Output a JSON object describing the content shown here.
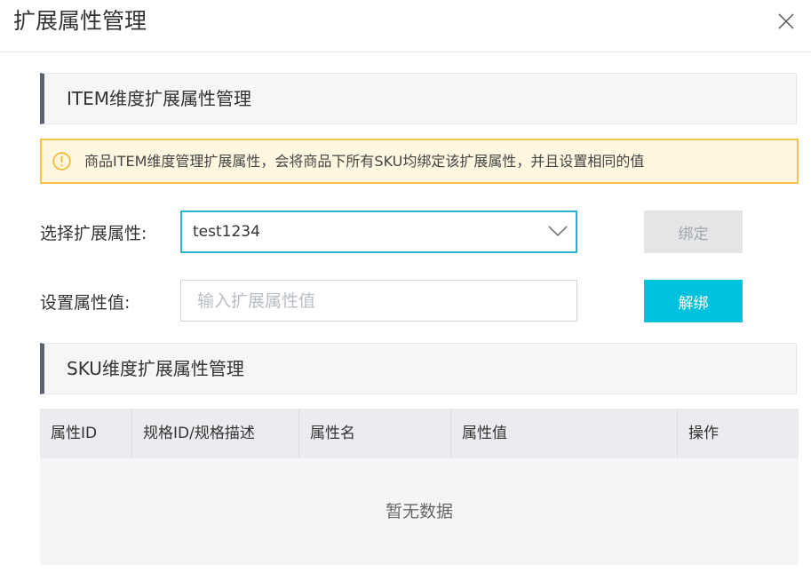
{
  "dialog": {
    "title": "扩展属性管理"
  },
  "item_section": {
    "title": "ITEM维度扩展属性管理",
    "alert_text": "商品ITEM维度管理扩展属性，会将商品下所有SKU均绑定该扩展属性，并且设置相同的值",
    "select_label": "选择扩展属性:",
    "select_value": "test1234",
    "value_label": "设置属性值:",
    "value_placeholder": "输入扩展属性值",
    "bind_button": "绑定",
    "unbind_button": "解绑"
  },
  "sku_section": {
    "title": "SKU维度扩展属性管理",
    "columns": [
      "属性ID",
      "规格ID/规格描述",
      "属性名",
      "属性值",
      "操作"
    ],
    "empty_text": "暂无数据"
  },
  "colors": {
    "accent": "#00c1de",
    "select_border": "#25b6d2",
    "alert_border": "#f5c34a",
    "alert_bg": "#fff7e0"
  },
  "icons": {
    "close": "close-icon",
    "alert": "warning-circle-icon",
    "dropdown": "chevron-down-icon"
  }
}
